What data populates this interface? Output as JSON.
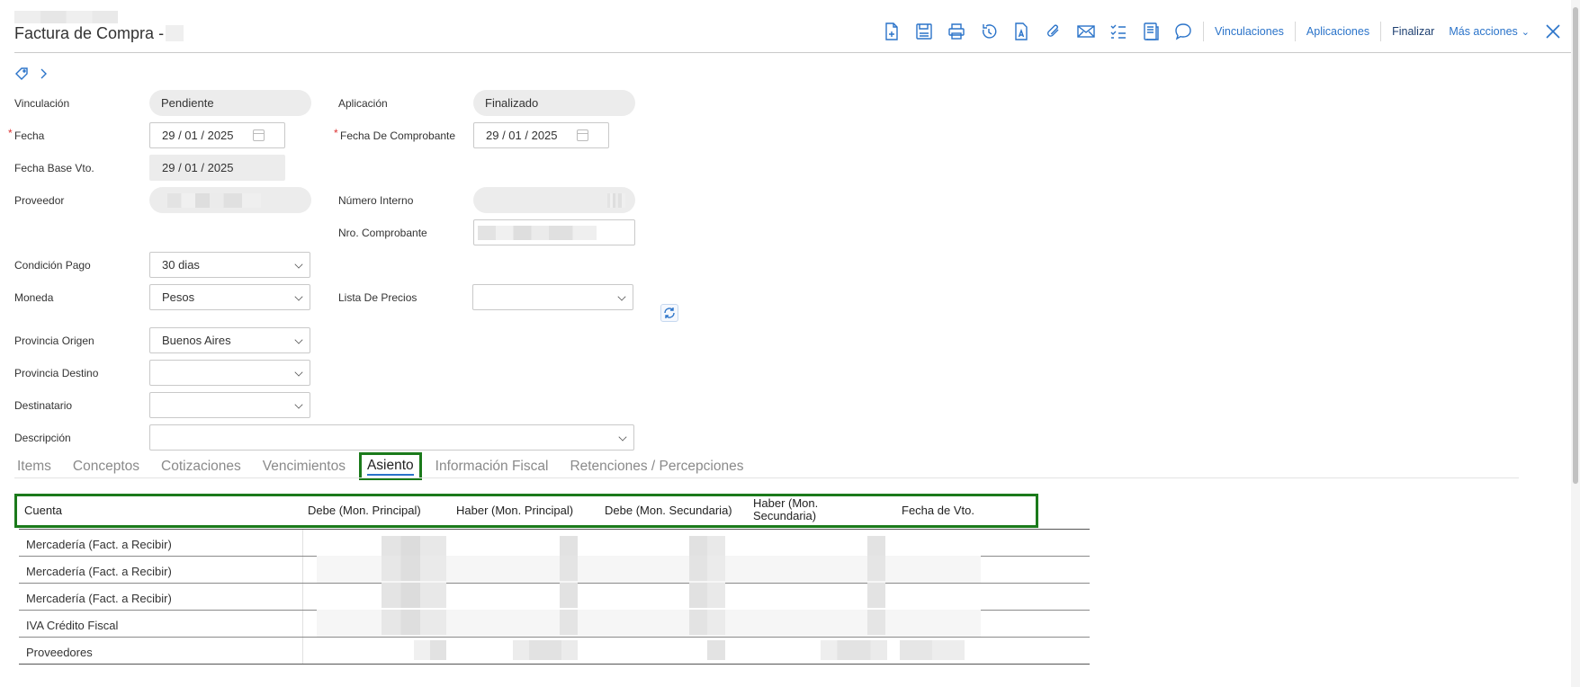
{
  "header": {
    "title": "Factura de Compra -",
    "actions": {
      "vinculaciones": "Vinculaciones",
      "aplicaciones": "Aplicaciones",
      "finalizar": "Finalizar",
      "mas_acciones": "Más acciones"
    },
    "icons": [
      "new-document-icon",
      "save-icon",
      "print-icon",
      "undo-icon",
      "document-a-icon",
      "attachment-icon",
      "mail-icon",
      "checklist-icon",
      "notes-icon",
      "comment-icon",
      "close-icon"
    ],
    "accent_color": "#2a73c9"
  },
  "form": {
    "vinculacion": {
      "label": "Vinculación",
      "value": "Pendiente"
    },
    "aplicacion": {
      "label": "Aplicación",
      "value": "Finalizado"
    },
    "fecha": {
      "label": "Fecha",
      "value": "29 / 01 / 2025",
      "required": "*"
    },
    "fecha_comprobante": {
      "label": "Fecha De Comprobante",
      "value": "29 / 01 / 2025",
      "required": "*"
    },
    "fecha_base_vto": {
      "label": "Fecha Base Vto.",
      "value": "29 / 01 / 2025"
    },
    "proveedor": {
      "label": "Proveedor"
    },
    "numero_interno": {
      "label": "Número Interno"
    },
    "nro_comprobante": {
      "label": "Nro. Comprobante"
    },
    "condicion_pago": {
      "label": "Condición Pago",
      "value": "30 dias"
    },
    "moneda": {
      "label": "Moneda",
      "value": "Pesos"
    },
    "lista_precios": {
      "label": "Lista De Precios",
      "value": ""
    },
    "provincia_origen": {
      "label": "Provincia Origen",
      "value": "Buenos Aires"
    },
    "provincia_destino": {
      "label": "Provincia Destino",
      "value": ""
    },
    "destinatario": {
      "label": "Destinatario",
      "value": ""
    },
    "descripcion": {
      "label": "Descripción",
      "value": ""
    }
  },
  "tabs": [
    {
      "label": "Items"
    },
    {
      "label": "Conceptos"
    },
    {
      "label": "Cotizaciones"
    },
    {
      "label": "Vencimientos"
    },
    {
      "label": "Asiento",
      "active": true
    },
    {
      "label": "Información Fiscal"
    },
    {
      "label": "Retenciones / Percepciones"
    }
  ],
  "table": {
    "columns": [
      "Cuenta",
      "Debe (Mon. Principal)",
      "Haber (Mon. Principal)",
      "Debe (Mon. Secundaria)",
      "Haber (Mon.",
      "Secundaria)",
      "Fecha de Vto."
    ],
    "rows": [
      {
        "cuenta": "Mercadería (Fact. a Recibir)"
      },
      {
        "cuenta": "Mercadería (Fact. a Recibir)"
      },
      {
        "cuenta": "Mercadería (Fact. a Recibir)"
      },
      {
        "cuenta": "IVA Crédito Fiscal"
      },
      {
        "cuenta": "Proveedores"
      }
    ]
  }
}
